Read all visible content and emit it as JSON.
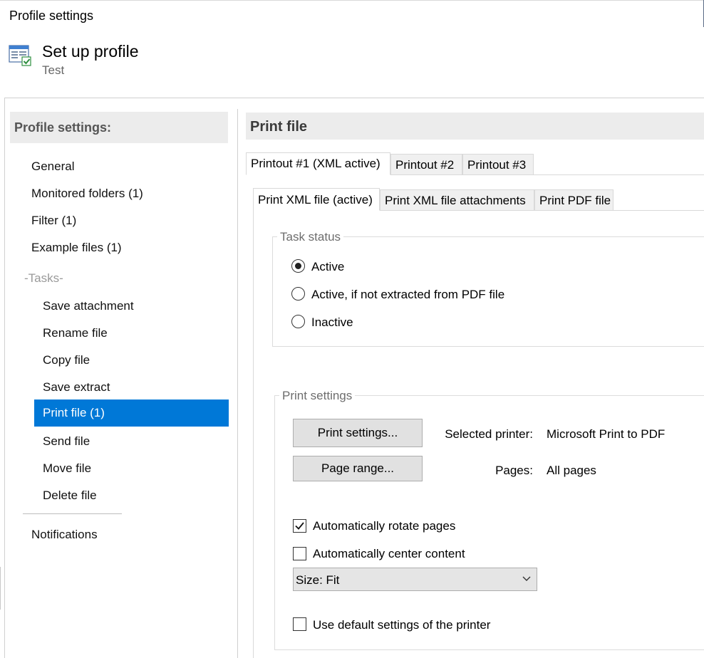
{
  "window": {
    "title": "Profile settings"
  },
  "header": {
    "title": "Set up profile",
    "subtitle": "Test",
    "icon": "profile-settings-icon"
  },
  "sidebar": {
    "header": "Profile settings:",
    "items": [
      {
        "label": "General"
      },
      {
        "label": "Monitored folders (1)"
      },
      {
        "label": "Filter (1)"
      },
      {
        "label": "Example files (1)"
      }
    ],
    "tasks_group_label": "-Tasks-",
    "tasks": [
      {
        "label": "Save attachment"
      },
      {
        "label": "Rename file"
      },
      {
        "label": "Copy file"
      },
      {
        "label": "Save extract"
      },
      {
        "label": "Print file (1)",
        "selected": true
      },
      {
        "label": "Send file"
      },
      {
        "label": "Move file"
      },
      {
        "label": "Delete file"
      }
    ],
    "footer_items": [
      {
        "label": "Notifications"
      }
    ]
  },
  "main": {
    "title": "Print file",
    "printout_tabs": [
      {
        "label": "Printout #1 (XML active)",
        "active": true
      },
      {
        "label": "Printout #2"
      },
      {
        "label": "Printout #3"
      }
    ],
    "file_tabs": [
      {
        "label": "Print XML file (active)",
        "active": true
      },
      {
        "label": "Print XML file attachments"
      },
      {
        "label": "Print PDF file"
      }
    ],
    "task_status": {
      "title": "Task status",
      "options": [
        {
          "label": "Active",
          "selected": true
        },
        {
          "label": "Active, if not extracted from PDF file",
          "selected": false
        },
        {
          "label": "Inactive",
          "selected": false
        }
      ]
    },
    "print_settings": {
      "title": "Print settings",
      "print_settings_button": "Print settings...",
      "page_range_button": "Page range...",
      "selected_printer_label": "Selected printer:",
      "selected_printer_value": "Microsoft Print to PDF",
      "pages_label": "Pages:",
      "pages_value": "All pages",
      "auto_rotate": {
        "label": "Automatically rotate pages",
        "checked": true
      },
      "auto_center": {
        "label": "Automatically center content",
        "checked": false
      },
      "size_select": {
        "value": "Size: Fit"
      },
      "use_default": {
        "label": "Use default settings of the printer",
        "checked": false
      }
    }
  },
  "colors": {
    "selection": "#0078d7",
    "header_bg": "#ececec",
    "button_bg": "#e1e1e1"
  }
}
